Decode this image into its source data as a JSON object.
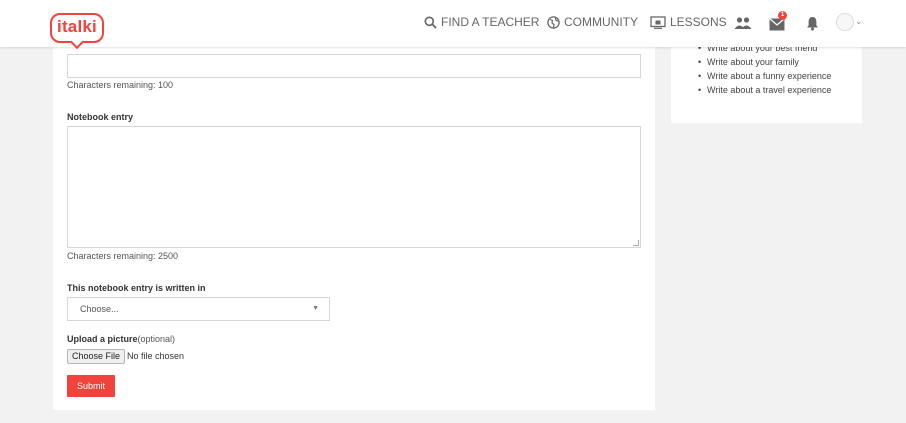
{
  "header": {
    "logo_text": "italki",
    "nav": {
      "find_teacher": "FIND A TEACHER",
      "community": "COMMUNITY",
      "lessons": "LESSONS"
    },
    "message_badge": "1",
    "icons": [
      "search-icon",
      "globe-icon",
      "lessons-icon",
      "people-icon",
      "mail-icon",
      "bell-icon",
      "avatar",
      "chevron-down-icon"
    ]
  },
  "form": {
    "title_chars_remaining": "Characters remaining: 100",
    "notebook_label": "Notebook entry",
    "notebook_value": "",
    "notebook_chars_remaining": "Characters remaining: 2500",
    "language_label": "This notebook entry is written in",
    "language_selected": "Choose...",
    "upload_label": "Upload a picture",
    "upload_optional": "(optional)",
    "file_button": "Choose File",
    "file_status": "No file chosen",
    "submit_label": "Submit"
  },
  "sidebar": {
    "suggestions": [
      "Write about your best friend",
      "Write about your family",
      "Write about a funny experience",
      "Write about a travel experience"
    ]
  },
  "colors": {
    "brand": "#f1433b",
    "background": "#f2f2f2"
  }
}
